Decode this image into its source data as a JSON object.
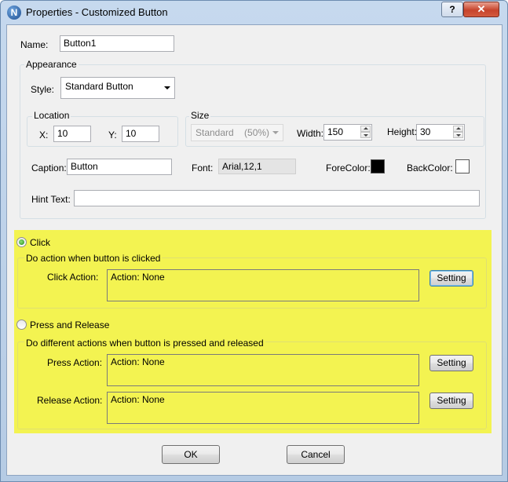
{
  "window": {
    "title": "Properties - Customized Button",
    "help": "?",
    "close": "✕",
    "icon": "N"
  },
  "name": {
    "label": "Name:",
    "value": "Button1"
  },
  "appearance": {
    "title": "Appearance",
    "style_label": "Style:",
    "style_value": "Standard Button",
    "location": {
      "title": "Location",
      "x_label": "X:",
      "x_value": "10",
      "y_label": "Y:",
      "y_value": "10"
    },
    "size": {
      "title": "Size",
      "preset": "Standard    (50%)",
      "width_label": "Width:",
      "width_value": "150",
      "height_label": "Height:",
      "height_value": "30"
    },
    "caption_label": "Caption:",
    "caption_value": "Button",
    "font_label": "Font:",
    "font_value": "Arial,12,1",
    "forecolor_label": "ForeColor:",
    "forecolor": "#000000",
    "backcolor_label": "BackColor:",
    "backcolor": "#ffffff",
    "hint_label": "Hint Text:",
    "hint_value": ""
  },
  "click": {
    "radio_label": "Click",
    "group_title": "Do action when button is clicked",
    "action_label": "Click Action:",
    "action_value": "Action: None",
    "setting_label": "Setting"
  },
  "press_release": {
    "radio_label": "Press and Release",
    "group_title": "Do different actions when button is pressed and released",
    "press_label": "Press Action:",
    "press_value": "Action: None",
    "press_setting": "Setting",
    "release_label": "Release Action:",
    "release_value": "Action: None",
    "release_setting": "Setting"
  },
  "footer": {
    "ok": "OK",
    "cancel": "Cancel"
  },
  "colors": {
    "highlight": "#f3f351",
    "title_bar": "#c6d9ee",
    "close": "#c7442c"
  }
}
